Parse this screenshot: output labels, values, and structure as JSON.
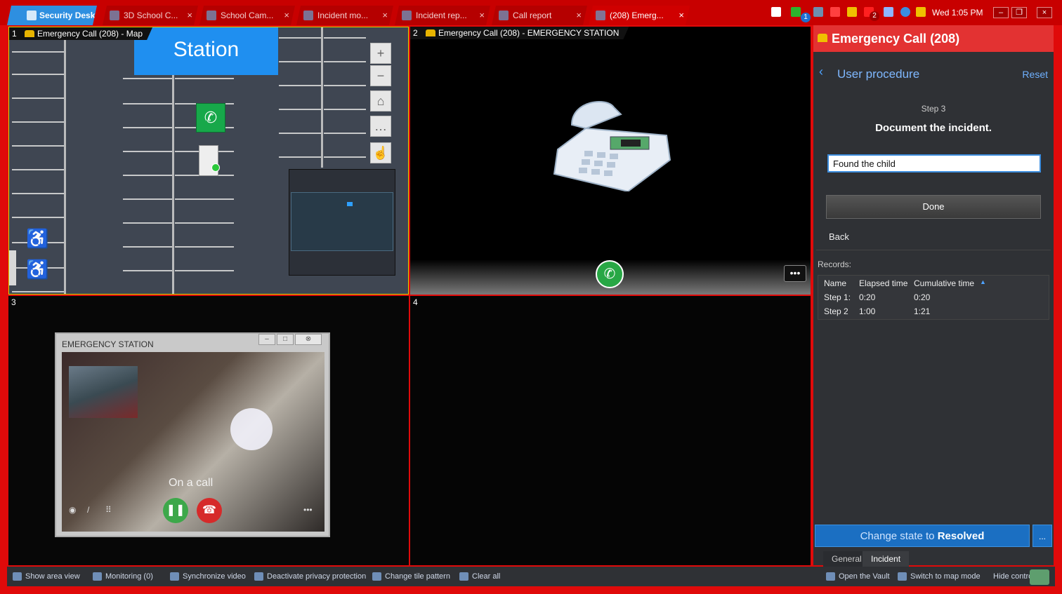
{
  "tabs": [
    {
      "label": "Security Desk"
    },
    {
      "label": "3D School C..."
    },
    {
      "label": "School Cam..."
    },
    {
      "label": "Incident mo..."
    },
    {
      "label": "Incident rep..."
    },
    {
      "label": "Call report"
    },
    {
      "label": "(208) Emerg..."
    }
  ],
  "tray": {
    "clock": "Wed 1:05 PM",
    "phone_badge": "1",
    "alert_badge": "2"
  },
  "tiles": {
    "t1": {
      "num": "1",
      "title": "Emergency Call (208) - Map",
      "station_label": "Station"
    },
    "t2": {
      "num": "2",
      "title": "Emergency Call (208) - EMERGENCY STATION",
      "more": "•••"
    },
    "t3": {
      "num": "3",
      "window_title": "EMERGENCY STATION",
      "status": "On a call"
    },
    "t4": {
      "num": "4"
    }
  },
  "panel": {
    "title": "Emergency Call (208)",
    "procedure": "User procedure",
    "reset": "Reset",
    "step": "Step 3",
    "step_desc": "Document the incident.",
    "note_value": "Found the child",
    "done": "Done",
    "back": "Back",
    "records_label": "Records:",
    "columns": [
      "Name",
      "Elapsed time",
      "Cumulative time"
    ],
    "rows": [
      [
        "Step 1:",
        "0:20",
        "0:20"
      ],
      [
        "Step 2",
        "1:00",
        "1:21"
      ]
    ],
    "change_state_prefix": "Change state to",
    "change_state_value": "Resolved",
    "more": "...",
    "bottom_tabs": [
      "General",
      "Incident"
    ]
  },
  "bottom": {
    "items": [
      "Show area view",
      "Monitoring (0)",
      "Synchronize video",
      "Deactivate privacy protection",
      "Change tile pattern",
      "Clear all"
    ],
    "right_items": [
      "Open the Vault",
      "Switch to map mode",
      "Hide controls"
    ]
  },
  "colors": {
    "brand_red": "#e00a0a",
    "accent_blue": "#1f8ff0",
    "call_green": "#28a745"
  }
}
